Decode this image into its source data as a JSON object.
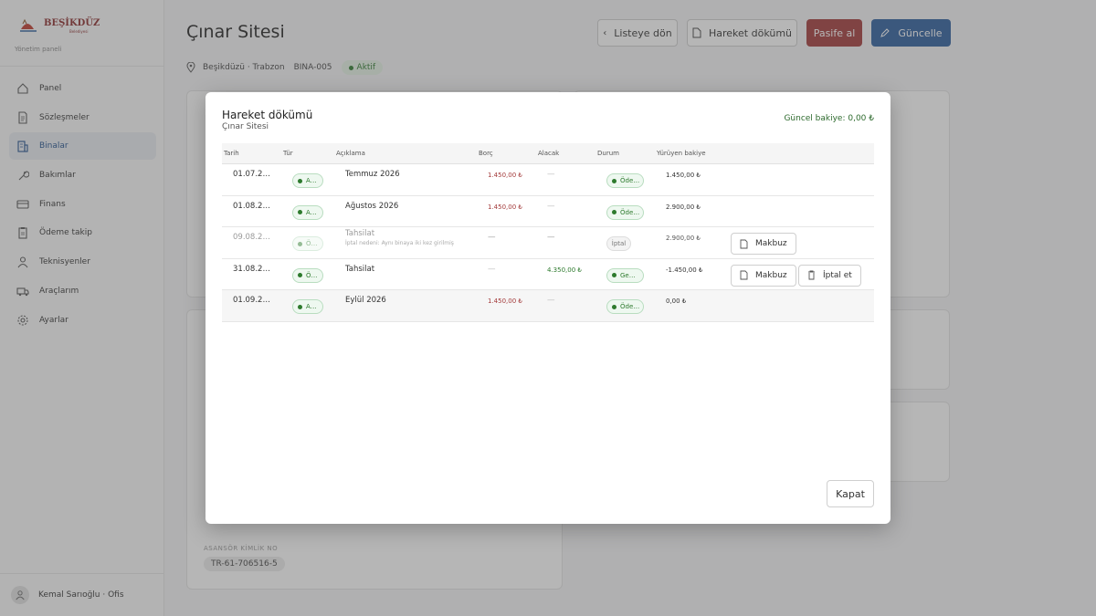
{
  "sidebar": {
    "logo_text": "BEŞİKDÜZÜ",
    "logo_sub": "Belediyesi",
    "panel_label": "Yönetim paneli",
    "items": [
      {
        "label": "Panel",
        "icon": "home-icon"
      },
      {
        "label": "Sözleşmeler",
        "icon": "document-icon"
      },
      {
        "label": "Binalar",
        "icon": "building-icon",
        "active": true
      },
      {
        "label": "Bakımlar",
        "icon": "wrench-icon"
      },
      {
        "label": "Finans",
        "icon": "card-icon"
      },
      {
        "label": "Ödeme takip",
        "icon": "clipboard-icon"
      },
      {
        "label": "Teknisyenler",
        "icon": "person-icon"
      },
      {
        "label": "Araçlarım",
        "icon": "truck-icon"
      },
      {
        "label": "Ayarlar",
        "icon": "gear-icon"
      }
    ],
    "user": "Kemal Sarıoğlu · Ofis"
  },
  "header": {
    "title": "Çınar Sitesi",
    "back_label": "Listeye dön",
    "history_label": "Hareket dökümü",
    "deactivate_label": "Pasife al",
    "update_label": "Güncelle",
    "location": "Beşikdüzü · Trabzon",
    "code": "BINA-005",
    "status": "Aktif"
  },
  "background_card": {
    "elevator_label": "ASANSÖR KİMLİK NO",
    "elevator_id": "TR-61-706516-5"
  },
  "modal": {
    "title": "Hareket dökümü",
    "subtitle": "Çınar Sitesi",
    "balance": "Güncel bakiye: 0,00 ₺",
    "columns": [
      "Tarih",
      "Tür",
      "Açıklama",
      "Borç",
      "Alacak",
      "Durum",
      "Yürüyen bakiye"
    ],
    "rows": [
      {
        "date": "01.07.2…",
        "type": "A…",
        "desc": "Temmuz 2026",
        "note": "",
        "debt": "1.450,00 ₺",
        "credit": "—",
        "status": "Öde…",
        "balance": "1.450,00 ₺"
      },
      {
        "date": "01.08.2…",
        "type": "A…",
        "desc": "Ağustos 2026",
        "note": "",
        "debt": "1.450,00 ₺",
        "credit": "—",
        "status": "Öde…",
        "balance": "2.900,00 ₺"
      },
      {
        "date": "09.08.2…",
        "type": "Ö…",
        "desc": "Tahsilat",
        "note": "İptal nedeni: Aynı binaya iki kez girilmiş",
        "debt": "—",
        "credit": "—",
        "status": "İptal",
        "balance": "2.900,00 ₺",
        "btn1": "Makbuz"
      },
      {
        "date": "31.08.2…",
        "type": "Ö…",
        "desc": "Tahsilat",
        "note": "",
        "debt": "—",
        "credit": "4.350,00 ₺",
        "status": "Ge…",
        "balance": "-1.450,00 ₺",
        "btn1": "Makbuz",
        "btn2": "İptal et"
      },
      {
        "date": "01.09.2…",
        "type": "A…",
        "desc": "Eylül 2026",
        "note": "",
        "debt": "1.450,00 ₺",
        "credit": "—",
        "status": "Öde…",
        "balance": "0,00 ₺"
      }
    ],
    "close_label": "Kapat"
  }
}
